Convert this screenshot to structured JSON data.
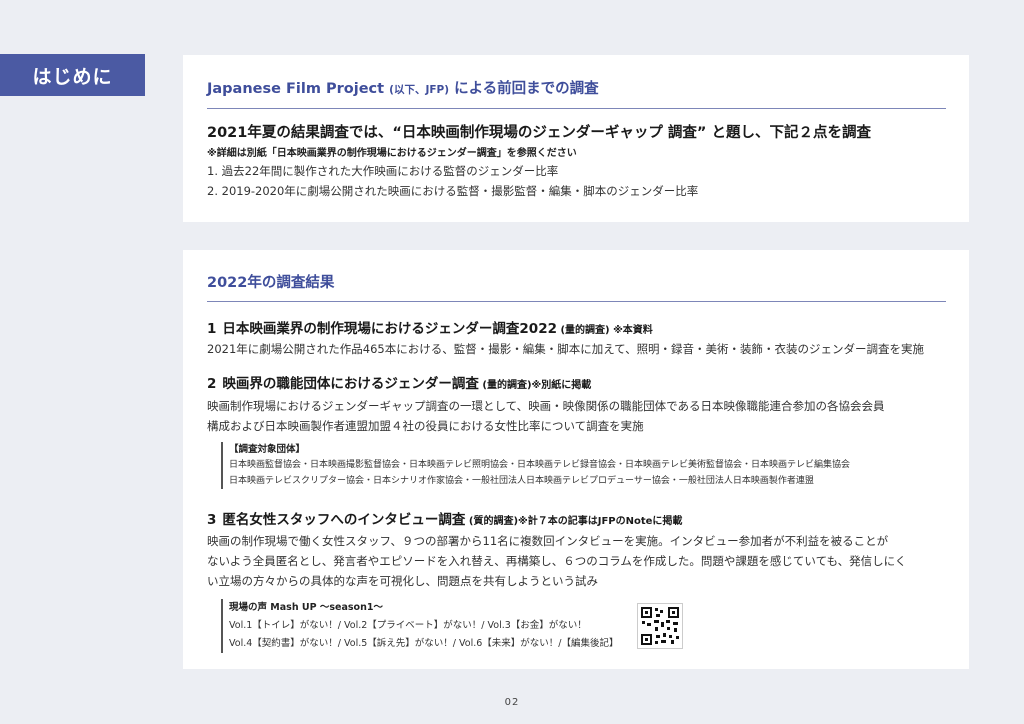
{
  "section_tag": "はじめに",
  "card1": {
    "title_main": "Japanese Film Project ",
    "title_small": "(以下、JFP)",
    "title_rest": " による前回までの調査",
    "heading": "2021年夏の結果調査では、“日本映画制作現場のジェンダーギャップ 調査” と題し、下記２点を調査",
    "note": "※詳細は別紙「日本映画業界の制作現場におけるジェンダー調査」を参照ください",
    "items": [
      "1. 過去22年間に製作された大作映画における監督のジェンダー比率",
      "2. 2019-2020年に劇場公開された映画における監督・撮影監督・編集・脚本のジェンダー比率"
    ]
  },
  "card2": {
    "title": "2022年の調査結果",
    "s1": {
      "num": "1",
      "title": "日本映画業界の制作現場におけるジェンダー調査2022",
      "tag": " (量的調査) ※本資料",
      "body": "2021年に劇場公開された作品465本における、監督・撮影・編集・脚本に加えて、照明・録音・美術・装飾・衣装のジェンダー調査を実施"
    },
    "s2": {
      "num": "2",
      "title": "映画界の職能団体におけるジェンダー調査",
      "tag": " (量的調査)※別紙に掲載",
      "body": [
        "映画制作現場におけるジェンダーギャップ調査の一環として、映画・映像関係の職能団体である日本映像職能連合参加の各協会会員",
        "構成および日本映画製作者連盟加盟４社の役員における女性比率について調査を実施"
      ],
      "box_head": "【調査対象団体】",
      "box_lines": [
        "日本映画監督協会・日本映画撮影監督協会・日本映画テレビ照明協会・日本映画テレビ録音協会・日本映画テレビ美術監督協会・日本映画テレビ編集協会",
        "日本映画テレビスクリプター協会・日本シナリオ作家協会・一般社団法人日本映画テレビプロデューサー協会・一般社団法人日本映画製作者連盟"
      ]
    },
    "s3": {
      "num": "3",
      "title": "匿名女性スタッフへのインタビュー調査",
      "tag": " (質的調査)※計７本の記事はJFPのNoteに掲載",
      "body": [
        "映画の制作現場で働く女性スタッフ、９つの部署から11名に複数回インタビューを実施。インタビュー参加者が不利益を被ることが",
        "ないよう全員匿名とし、発言者やエピソードを入れ替え、再構築し、６つのコラムを作成した。問題や課題を感じていても、発信しにく",
        "い立場の方々からの具体的な声を可視化し、問題点を共有しようという試み"
      ],
      "box_head": "現場の声 Mash UP 〜season1〜",
      "box_lines": [
        "Vol.1【トイレ】がない！/  Vol.2【プライベート】がない！/  Vol.3【お金】がない！",
        "Vol.4【契約書】がない！/ Vol.5【訴え先】がない！/ Vol.6【未来】がない！/【編集後記】"
      ],
      "qr_icon": "qr-code-icon"
    }
  },
  "page_number": "02"
}
